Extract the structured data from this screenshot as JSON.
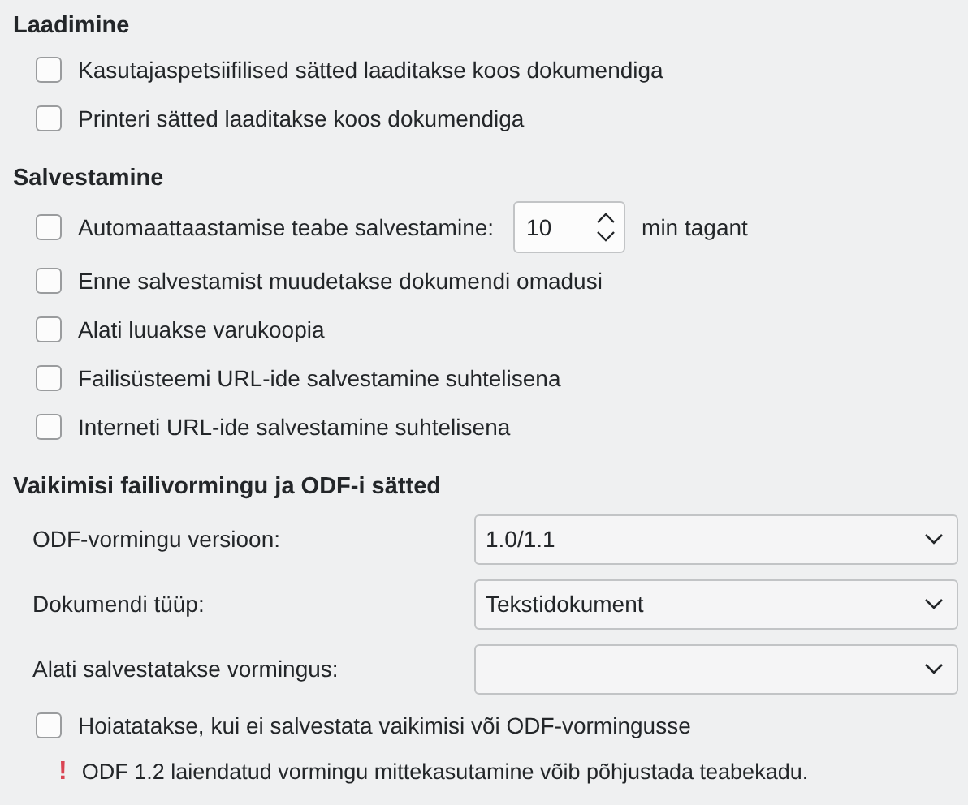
{
  "sections": [
    {
      "heading": "Laadimine",
      "items": [
        {
          "kind": "checkbox",
          "label": "Kasutajaspetsiifilised sätted laaditakse koos dokumendiga",
          "checked": false
        },
        {
          "kind": "checkbox",
          "label": "Printeri sätted laaditakse koos dokumendiga",
          "checked": false
        }
      ]
    },
    {
      "heading": "Salvestamine",
      "items": [
        {
          "kind": "spin",
          "label": "Automaattaastamise teabe salvestamine:",
          "checked": false,
          "value": "10",
          "suffix": "min tagant"
        },
        {
          "kind": "checkbox",
          "label": "Enne salvestamist muudetakse dokumendi omadusi",
          "checked": false
        },
        {
          "kind": "checkbox",
          "label": "Alati luuakse varukoopia",
          "checked": false
        },
        {
          "kind": "checkbox",
          "label": "Failisüsteemi URL-ide salvestamine suhtelisena",
          "checked": false
        },
        {
          "kind": "checkbox",
          "label": "Interneti URL-ide salvestamine suhtelisena",
          "checked": false
        }
      ]
    },
    {
      "heading": "Vaikimisi failivormingu ja ODF-i sätted",
      "items": [
        {
          "kind": "select",
          "label": "ODF-vormingu versioon:",
          "value": "1.0/1.1"
        },
        {
          "kind": "select",
          "label": "Dokumendi tüüp:",
          "value": "Tekstidokument"
        },
        {
          "kind": "select",
          "label": "Alati salvestatakse vormingus:"
        },
        {
          "kind": "checkbox",
          "label": "Hoiatatakse, kui ei salvestata vaikimisi või ODF-vormingusse",
          "checked": false
        },
        {
          "kind": "warning",
          "icon": "!",
          "text": "ODF 1.2 laiendatud vormingu mittekasutamine võib põhjustada teabekadu."
        }
      ]
    }
  ]
}
